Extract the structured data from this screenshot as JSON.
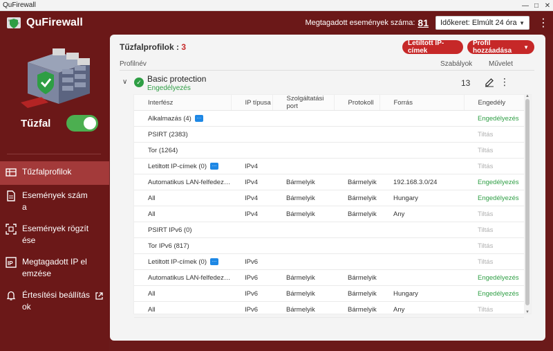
{
  "window": {
    "title": "QuFirewall"
  },
  "header": {
    "brand": "QuFirewall",
    "denied_label": "Megtagadott események száma:",
    "denied_count": "81",
    "timeframe": "Időkeret: Elmúlt 24 óra"
  },
  "sidebar": {
    "firewall_label": "Tűzfal",
    "firewall_enabled": true,
    "items": [
      {
        "label": "Tűzfalprofilok",
        "icon": "profiles-icon",
        "active": true
      },
      {
        "label": "Események száma",
        "icon": "document-icon",
        "active": false
      },
      {
        "label": "Események rögzítése",
        "icon": "record-icon",
        "active": false
      },
      {
        "label": "Megtagadott IP elemzése",
        "icon": "ip-icon",
        "active": false
      },
      {
        "label": "Értesítési beállítások",
        "icon": "bell-icon",
        "active": false
      }
    ]
  },
  "main": {
    "title_label": "Tűzfalprofilok :",
    "title_count": "3",
    "blocked_button": "Letiltott IP-címek",
    "add_button": "Profil hozzáadása",
    "columns": {
      "name": "Profilnév",
      "rules": "Szabályok",
      "action": "Művelet"
    },
    "profile": {
      "name": "Basic protection",
      "status": "Engedélyezés",
      "rules": "13"
    },
    "rules_table": {
      "headers": [
        "Interfész",
        "IP típusa",
        "Szolgáltatási port",
        "Protokoll",
        "Forrás",
        "Engedély"
      ],
      "rows": [
        {
          "iface": "Alkalmazás (4)",
          "msg": true,
          "ip": "",
          "port": "",
          "proto": "",
          "src": "",
          "perm": "Engedélyezés",
          "allow": true
        },
        {
          "iface": "PSIRT (2383)",
          "msg": false,
          "ip": "",
          "port": "",
          "proto": "",
          "src": "",
          "perm": "Tiltás",
          "allow": false
        },
        {
          "iface": "Tor (1264)",
          "msg": false,
          "ip": "",
          "port": "",
          "proto": "",
          "src": "",
          "perm": "Tiltás",
          "allow": false
        },
        {
          "iface": "Letiltott IP-címek (0)",
          "msg": true,
          "ip": "IPv4",
          "port": "",
          "proto": "",
          "src": "",
          "perm": "Tiltás",
          "allow": false
        },
        {
          "iface": "Automatikus LAN-felfedezés...",
          "msg": false,
          "ip": "IPv4",
          "port": "Bármelyik",
          "proto": "Bármelyik",
          "src": "192.168.3.0/24",
          "perm": "Engedélyezés",
          "allow": true
        },
        {
          "iface": "All",
          "msg": false,
          "ip": "IPv4",
          "port": "Bármelyik",
          "proto": "Bármelyik",
          "src": "Hungary",
          "perm": "Engedélyezés",
          "allow": true
        },
        {
          "iface": "All",
          "msg": false,
          "ip": "IPv4",
          "port": "Bármelyik",
          "proto": "Bármelyik",
          "src": "Any",
          "perm": "Tiltás",
          "allow": false
        },
        {
          "iface": "PSIRT IPv6 (0)",
          "msg": false,
          "ip": "",
          "port": "",
          "proto": "",
          "src": "",
          "perm": "Tiltás",
          "allow": false
        },
        {
          "iface": "Tor IPv6 (817)",
          "msg": false,
          "ip": "",
          "port": "",
          "proto": "",
          "src": "",
          "perm": "Tiltás",
          "allow": false
        },
        {
          "iface": "Letiltott IP-címek (0)",
          "msg": true,
          "ip": "IPv6",
          "port": "",
          "proto": "",
          "src": "",
          "perm": "Tiltás",
          "allow": false
        },
        {
          "iface": "Automatikus LAN-felfedezés...",
          "msg": false,
          "ip": "IPv6",
          "port": "Bármelyik",
          "proto": "Bármelyik",
          "src": "",
          "perm": "Engedélyezés",
          "allow": true
        },
        {
          "iface": "All",
          "msg": false,
          "ip": "IPv6",
          "port": "Bármelyik",
          "proto": "Bármelyik",
          "src": "Hungary",
          "perm": "Engedélyezés",
          "allow": true
        },
        {
          "iface": "All",
          "msg": false,
          "ip": "IPv6",
          "port": "Bármelyik",
          "proto": "Bármelyik",
          "src": "Any",
          "perm": "Tiltás",
          "allow": false
        }
      ]
    }
  },
  "colors": {
    "brand": "#6b1818",
    "accent": "#c62828",
    "allow": "#2e9e44",
    "deny": "#b0b0b0",
    "active_nav": "#a33a3a"
  }
}
